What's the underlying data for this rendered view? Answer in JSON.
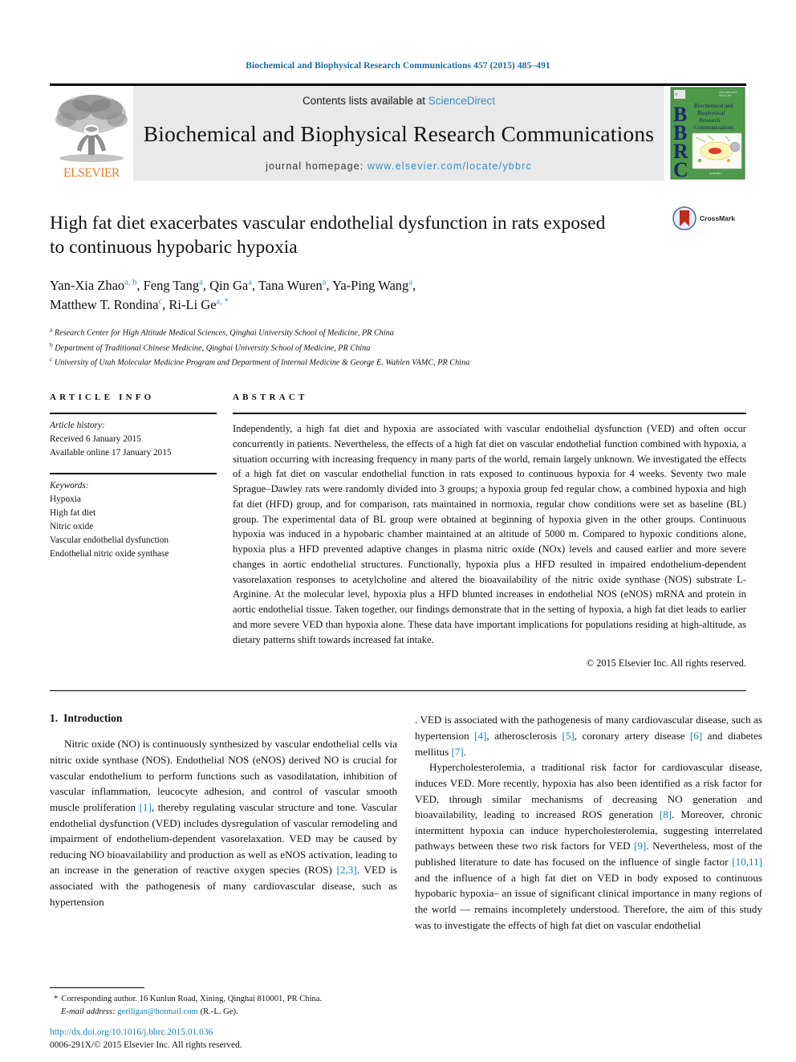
{
  "running_head": "Biochemical and Biophysical Research Communications 457 (2015) 485–491",
  "masthead": {
    "publisher_name": "ELSEVIER",
    "contents_prefix": "Contents lists available at ",
    "contents_link": "ScienceDirect",
    "journal_title": "Biochemical and Biophysical Research Communications",
    "homepage_prefix": "journal homepage: ",
    "homepage_url": "www.elsevier.com/locate/ybbrc",
    "cover": {
      "letters": "BBRC",
      "title_lines": [
        "Biochemical and",
        "Biophysical",
        "Research",
        "Communications"
      ]
    },
    "colors": {
      "link": "#3b8fc4",
      "elsevier_orange": "#e87722",
      "band_background": "#e9e9e9",
      "cover_green": "#4f9a4a"
    }
  },
  "article": {
    "title": "High fat diet exacerbates vascular endothelial dysfunction in rats exposed to continuous hypobaric hypoxia",
    "crossmark_label": "CrossMark",
    "authors_line_1": "Yan-Xia Zhao ",
    "authors": [
      {
        "name": "Yan-Xia Zhao",
        "marks": "a, b"
      },
      {
        "name": "Feng Tang",
        "marks": "a"
      },
      {
        "name": "Qin Ga",
        "marks": "a"
      },
      {
        "name": "Tana Wuren",
        "marks": "a"
      },
      {
        "name": "Ya-Ping Wang",
        "marks": "a"
      },
      {
        "name": "Matthew T. Rondina",
        "marks": "c"
      },
      {
        "name": "Ri-Li Ge",
        "marks": "a, *"
      }
    ],
    "affiliations": [
      {
        "mark": "a",
        "text": "Research Center for High Altitude Medical Sciences, Qinghai University School of Medicine, PR China"
      },
      {
        "mark": "b",
        "text": "Department of Traditional Chinese Medicine, Qinghai University School of Medicine, PR China"
      },
      {
        "mark": "c",
        "text": "University of Utah Molecular Medicine Program and Department of Internal Medicine & George E. Wahlen VAMC, PR China"
      }
    ]
  },
  "article_info": {
    "heading": "ARTICLE INFO",
    "history_label": "Article history:",
    "history": [
      "Received 6 January 2015",
      "Available online 17 January 2015"
    ],
    "keywords_label": "Keywords:",
    "keywords": [
      "Hypoxia",
      "High fat diet",
      "Nitric oxide",
      "Vascular endothelial dysfunction",
      "Endothelial nitric oxide synthase"
    ]
  },
  "abstract": {
    "heading": "ABSTRACT",
    "text": "Independently, a high fat diet and hypoxia are associated with vascular endothelial dysfunction (VED) and often occur concurrently in patients. Nevertheless, the effects of a high fat diet on vascular endothelial function combined with hypoxia, a situation occurring with increasing frequency in many parts of the world, remain largely unknown. We investigated the effects of a high fat diet on vascular endothelial function in rats exposed to continuous hypoxia for 4 weeks. Seventy two male Sprague–Dawley rats were randomly divided into 3 groups; a hypoxia group fed regular chow, a combined hypoxia and high fat diet (HFD) group, and for comparison, rats maintained in normoxia, regular chow conditions were set as baseline (BL) group. The experimental data of BL group were obtained at beginning of hypoxia given in the other groups. Continuous hypoxia was induced in a hypobaric chamber maintained at an altitude of 5000 m. Compared to hypoxic conditions alone, hypoxia plus a HFD prevented adaptive changes in plasma nitric oxide (NOx) levels and caused earlier and more severe changes in aortic endothelial structures. Functionally, hypoxia plus a HFD resulted in impaired endothelium-dependent vasorelaxation responses to acetylcholine and altered the bioavailability of the nitric oxide synthase (NOS) substrate L-Arginine. At the molecular level, hypoxia plus a HFD blunted increases in endothelial NOS (eNOS) mRNA and protein in aortic endothelial tissue. Taken together, our findings demonstrate that in the setting of hypoxia, a high fat diet leads to earlier and more severe VED than hypoxia alone. These data have important implications for populations residing at high-altitude, as dietary patterns shift towards increased fat intake.",
    "copyright": "© 2015 Elsevier Inc. All rights reserved."
  },
  "introduction": {
    "number": "1.",
    "title": "Introduction",
    "paragraph_1_part_a": "Nitric oxide (NO) is continuously synthesized by vascular endothelial cells via nitric oxide synthase (NOS). Endothelial NOS (eNOS) derived NO is crucial for vascular endothelium to perform functions such as vasodilatation, inhibition of vascular inflammation, leucocyte adhesion, and control of vascular smooth muscle proliferation ",
    "ref_1": "[1]",
    "paragraph_1_part_b": ", thereby regulating vascular structure and tone. Vascular endothelial dysfunction (VED) includes dysregulation of vascular remodeling and impairment of endothelium-dependent vasorelaxation. VED may be caused by reducing NO bioavailability and production as well as eNOS activation, leading to an increase in the generation of reactive oxygen species (ROS) ",
    "ref_23": "[2,3]",
    "paragraph_1_part_c": ". VED is associated with the pathogenesis of many cardiovascular disease, such as hypertension ",
    "ref_4": "[4]",
    "paragraph_1_part_d": ", atherosclerosis ",
    "ref_5": "[5]",
    "paragraph_1_part_e": ", coronary artery disease ",
    "ref_6": "[6]",
    "paragraph_1_part_f": " and diabetes mellitus ",
    "ref_7": "[7]",
    "paragraph_1_part_g": ".",
    "paragraph_2_part_a": "Hypercholesterolemia, a traditional risk factor for cardiovascular disease, induces VED. More recently, hypoxia has also been identified as a risk factor for VED, through similar mechanisms of decreasing NO generation and bioavailability, leading to increased ROS generation ",
    "ref_8": "[8]",
    "paragraph_2_part_b": ". Moreover, chronic intermittent hypoxia can induce hypercholesterolemia, suggesting interrelated pathways between these two risk factors for VED ",
    "ref_9": "[9]",
    "paragraph_2_part_c": ". Nevertheless, most of the published literature to date has focused on the influence of single factor ",
    "ref_1011": "[10,11]",
    "paragraph_2_part_d": " and the influence of a high fat diet on VED in body exposed to continuous hypobaric hypoxia– an issue of significant clinical importance in many regions of the world — remains incompletely understood. Therefore, the aim of this study was to investigate the effects of high fat diet on vascular endothelial"
  },
  "footnotes": {
    "corresponding_star": "*",
    "corresponding_text": "Corresponding author. 16 Kunlun Road, Xining, Qinghai 810001, PR China.",
    "email_label": "E-mail address:",
    "email": "geriligan@hotmail.com",
    "email_owner": "(R.-L. Ge).",
    "doi": "http://dx.doi.org/10.1016/j.bbrc.2015.01.036",
    "issn_line": "0006-291X/© 2015 Elsevier Inc. All rights reserved."
  }
}
